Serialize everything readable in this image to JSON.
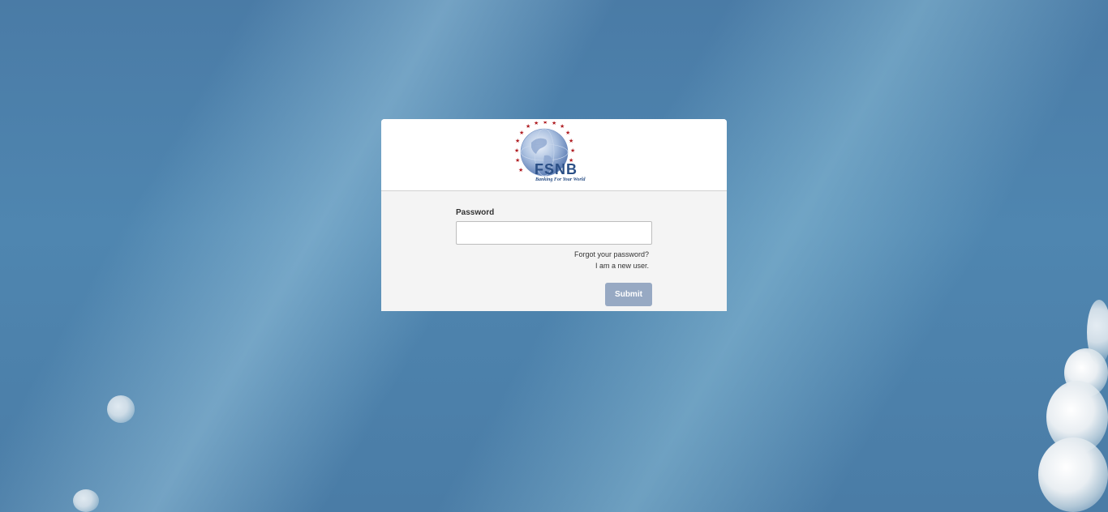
{
  "brand": {
    "name": "FSNB",
    "tagline": "Banking For Your World",
    "primary_color": "#2a4f86",
    "star_color": "#b01e23"
  },
  "login": {
    "password_label": "Password",
    "password_value": "",
    "password_placeholder": "",
    "forgot_link": "Forgot your password?",
    "new_user_link": "I am a new user.",
    "submit_label": "Submit",
    "submit_color": "#97a9c3"
  },
  "background": {
    "description_icon": "sky-clouds-background"
  }
}
